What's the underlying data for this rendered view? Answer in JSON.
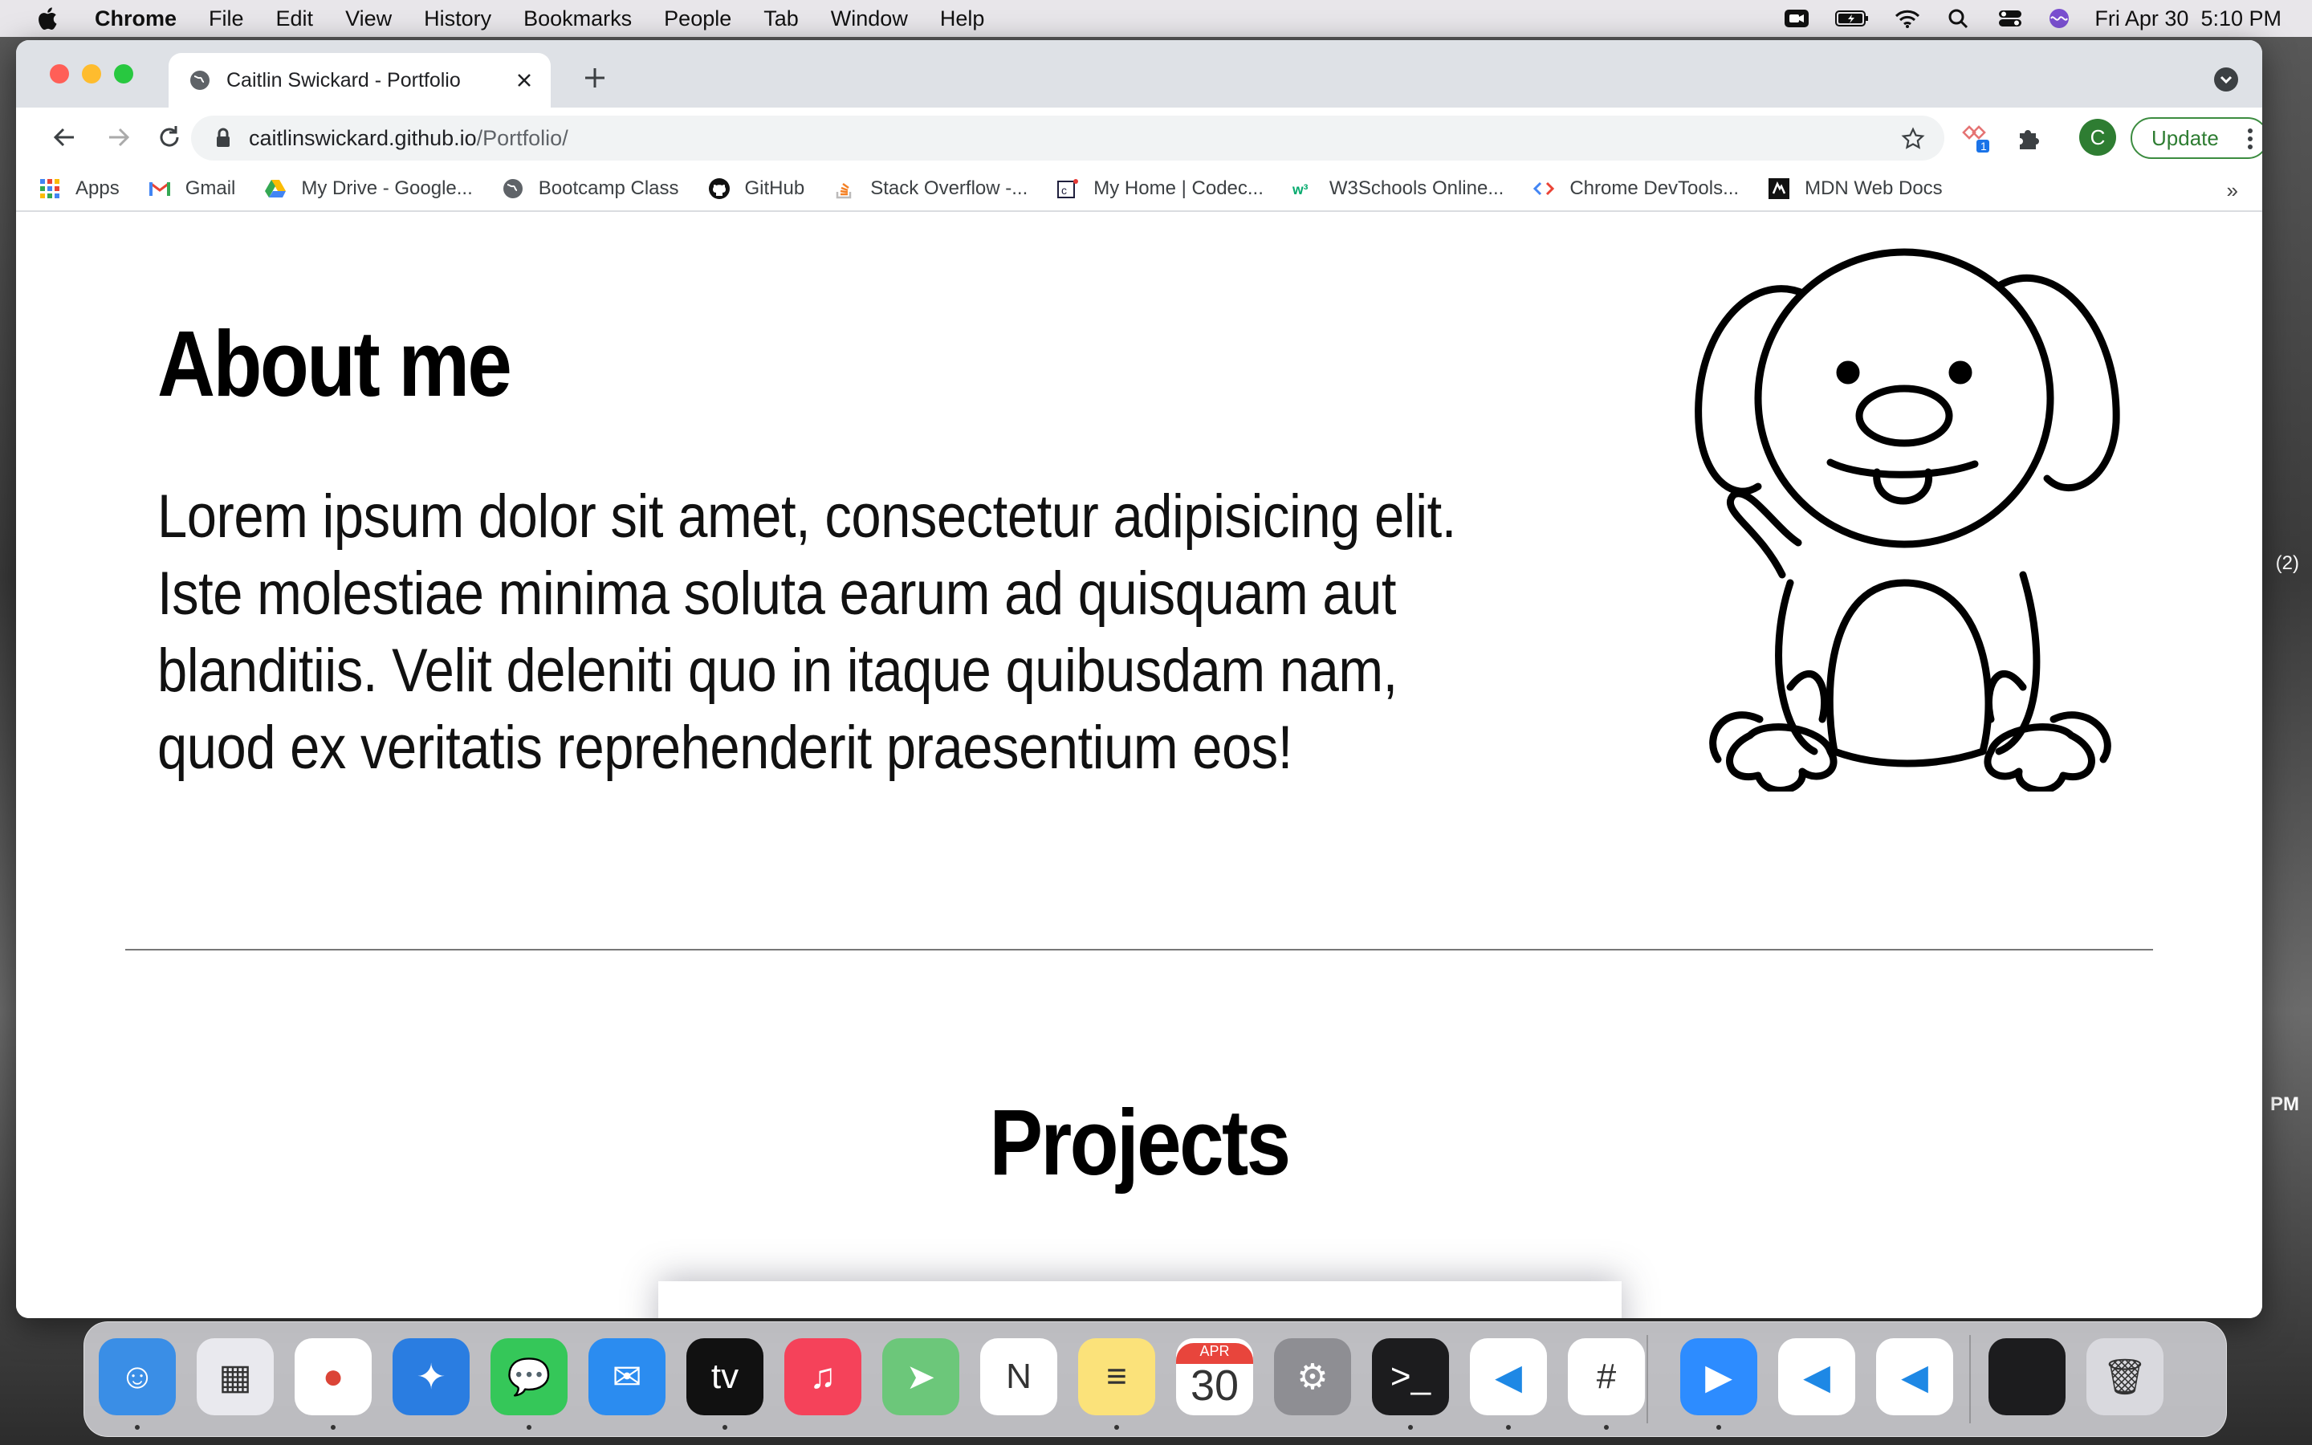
{
  "menubar": {
    "app_name": "Chrome",
    "menus": [
      "File",
      "Edit",
      "View",
      "History",
      "Bookmarks",
      "People",
      "Tab",
      "Window",
      "Help"
    ],
    "datetime": "Fri Apr 30  5:10 PM"
  },
  "browser": {
    "tab_title": "Caitlin Swickard - Portfolio",
    "url_host": "caitlinswickard.github.io",
    "url_path": "/Portfolio/",
    "extension_badge": "1",
    "avatar_letter": "C",
    "update_label": "Update",
    "bookmarks": [
      {
        "label": "Apps",
        "icon": "apps-grid-icon"
      },
      {
        "label": "Gmail",
        "icon": "gmail-icon"
      },
      {
        "label": "My Drive - Google...",
        "icon": "google-drive-icon"
      },
      {
        "label": "Bootcamp Class",
        "icon": "globe-icon"
      },
      {
        "label": "GitHub",
        "icon": "github-icon"
      },
      {
        "label": "Stack Overflow -...",
        "icon": "stack-overflow-icon"
      },
      {
        "label": "My Home | Codec...",
        "icon": "codecademy-icon"
      },
      {
        "label": "W3Schools Online...",
        "icon": "w3schools-icon"
      },
      {
        "label": "Chrome DevTools...",
        "icon": "devtools-icon"
      },
      {
        "label": "MDN Web Docs",
        "icon": "mdn-icon"
      }
    ],
    "bookmarks_overflow": "»"
  },
  "page": {
    "about_heading": "About me",
    "about_text": "Lorem ipsum dolor sit amet, consectetur adipisicing elit. Iste molestiae minima soluta earum ad quisquam aut blanditiis. Velit deleniti quo in itaque quibusdam nam, quod ex veritatis reprehenderit praesentium eos!",
    "projects_heading": "Projects",
    "dog_image": "cartoon-dog-illustration"
  },
  "desktop": {
    "fragments": [
      "(2)",
      "PM"
    ]
  },
  "dock": {
    "calendar_month": "APR",
    "calendar_day": "30",
    "apps": [
      {
        "name": "finder",
        "color": "#3a8ee6",
        "glyph": "☺"
      },
      {
        "name": "launchpad",
        "color": "#e9e9ee",
        "glyph": "▦"
      },
      {
        "name": "chrome",
        "color": "#ffffff",
        "glyph": "●"
      },
      {
        "name": "safari",
        "color": "#2a7de1",
        "glyph": "✦"
      },
      {
        "name": "messages",
        "color": "#35c759",
        "glyph": "💬"
      },
      {
        "name": "mail",
        "color": "#2b8cf0",
        "glyph": "✉"
      },
      {
        "name": "apple-tv",
        "color": "#111111",
        "glyph": "tv"
      },
      {
        "name": "music",
        "color": "#f5425a",
        "glyph": "♫"
      },
      {
        "name": "maps",
        "color": "#6cc77a",
        "glyph": "➤"
      },
      {
        "name": "news",
        "color": "#ffffff",
        "glyph": "N"
      },
      {
        "name": "notes",
        "color": "#fbe27a",
        "glyph": "≡"
      },
      {
        "name": "calendar",
        "color": "#ffffff",
        "glyph": ""
      },
      {
        "name": "system-preferences",
        "color": "#8e8e93",
        "glyph": "⚙"
      },
      {
        "name": "terminal",
        "color": "#1c1c1e",
        "glyph": ">_"
      },
      {
        "name": "vscode",
        "color": "#ffffff",
        "glyph": "◀"
      },
      {
        "name": "slack",
        "color": "#ffffff",
        "glyph": "#"
      },
      {
        "name": "zoom",
        "color": "#2d8cff",
        "glyph": "▶"
      },
      {
        "name": "vscode-2",
        "color": "#ffffff",
        "glyph": "◀"
      },
      {
        "name": "vscode-3",
        "color": "#ffffff",
        "glyph": "◀"
      },
      {
        "name": "window-minimized",
        "color": "#1c1c1e",
        "glyph": ""
      },
      {
        "name": "trash",
        "color": "#d9d9de",
        "glyph": "🗑"
      }
    ]
  },
  "colors": {
    "accent_green": "#2e7d32",
    "tab_strip": "#dee1e6"
  }
}
